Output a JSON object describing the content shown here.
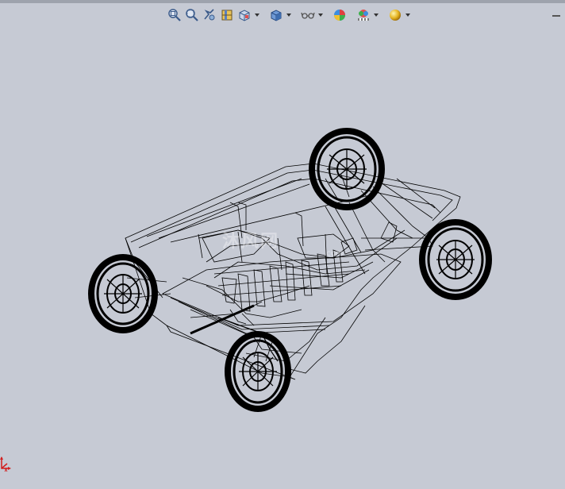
{
  "toolbar": {
    "items": [
      {
        "name": "zoom-to-fit-icon"
      },
      {
        "name": "zoom-to-area-icon"
      },
      {
        "name": "previous-view-icon"
      },
      {
        "name": "section-view-icon"
      },
      {
        "name": "view-orientation-icon"
      },
      {
        "name": "display-style-icon"
      },
      {
        "name": "hide-show-items-icon"
      },
      {
        "name": "edit-appearance-icon"
      },
      {
        "name": "apply-scene-icon"
      },
      {
        "name": "view-settings-icon"
      }
    ]
  },
  "colors": {
    "background": "#c6cad4",
    "wireframe": "#000000",
    "triad_red": "#d21e1e"
  },
  "watermark": {
    "brand_text": "沐风网",
    "domain_text": ".com"
  }
}
